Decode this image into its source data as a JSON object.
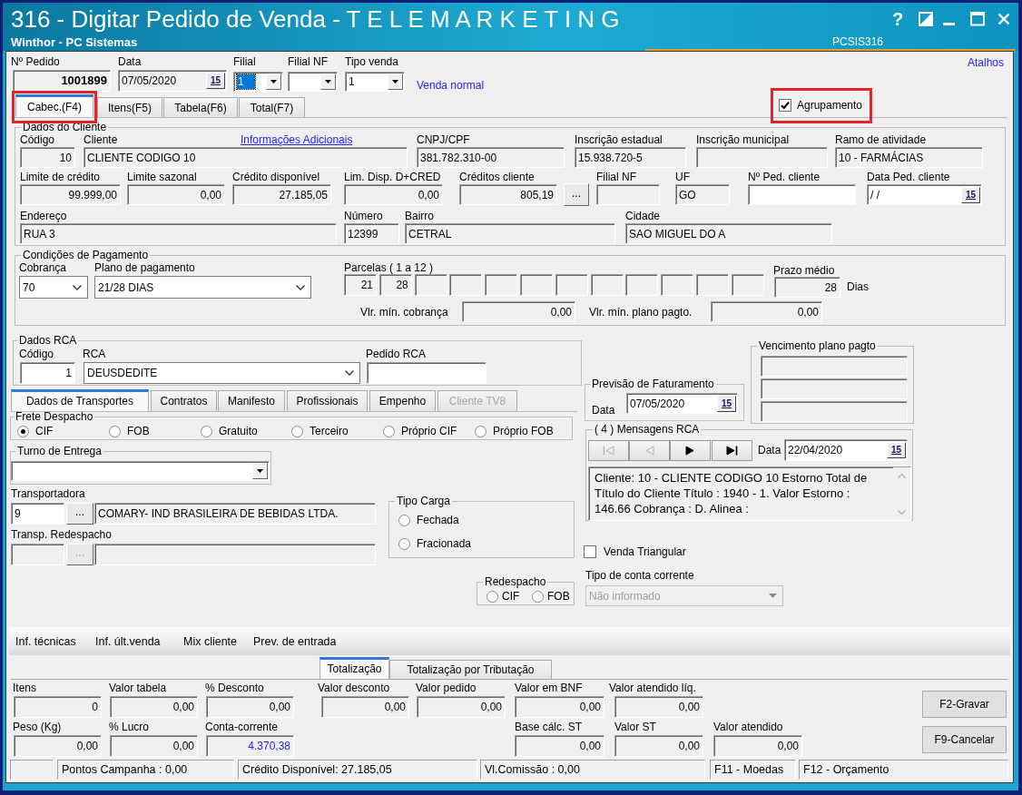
{
  "window": {
    "title": "316 - Digitar Pedido de Venda - T E L E M A R K E T I N G",
    "subtitle": "Winthor - PC Sistemas",
    "program_code": "PCSIS316",
    "help": "?"
  },
  "header": {
    "fields": [
      {
        "kind": "text",
        "label": "Nº Pedido",
        "value": "1001899",
        "readonly": true
      },
      {
        "kind": "date",
        "label": "Data",
        "value": "07/05/2020",
        "calendar": "15",
        "readonly": true
      },
      {
        "kind": "dropdown",
        "label": "Filial",
        "value": "1",
        "readonly": false,
        "focused": true
      },
      {
        "kind": "dropdown",
        "label": "Filial NF",
        "readonly": false,
        "focused": false
      },
      {
        "kind": "dropdown",
        "label": "Tipo venda",
        "value": "1",
        "readonly": false,
        "focused": false
      }
    ],
    "sale_type": "Venda normal",
    "shortcuts_link": "Atalhos"
  },
  "tabs": [
    {
      "label": "Cabec.(F4)",
      "selected": true,
      "highlighted": true
    },
    {
      "label": "Itens(F5)",
      "selected": false,
      "highlighted": false
    },
    {
      "label": "Tabela(F6)",
      "selected": false,
      "highlighted": false
    },
    {
      "label": "Total(F7)",
      "selected": false,
      "highlighted": false
    }
  ],
  "grouping": {
    "label": "Agrupamento",
    "checked": true,
    "highlighted": true
  },
  "client": {
    "title": "Dados do Cliente",
    "info_link": "Informações Adicionais",
    "fields": [
      {
        "kind": "text",
        "label": "Código",
        "value": "10",
        "readonly": true
      },
      {
        "kind": "text",
        "label": "Cliente",
        "value": "CLIENTE CODIGO 10",
        "readonly": true
      },
      {
        "kind": "text",
        "label": "CNPJ/CPF",
        "value": "381.782.310-00",
        "readonly": true
      },
      {
        "kind": "text",
        "label": "Inscrição estadual",
        "value": "15.938.720-5",
        "readonly": true
      },
      {
        "kind": "text",
        "label": "Inscrição municipal",
        "readonly": true
      },
      {
        "kind": "text",
        "label": "Ramo de atividade",
        "value": "10 - FARMÁCIAS",
        "readonly": true
      },
      {
        "kind": "text",
        "label": "Limite de crédito",
        "value": "99.999,00",
        "readonly": true
      },
      {
        "kind": "text",
        "label": "Limite sazonal",
        "value": "0,00",
        "readonly": true
      },
      {
        "kind": "text",
        "label": "Crédito disponível",
        "value": "27.185,05",
        "readonly": true
      },
      {
        "kind": "text",
        "label": "Lim. Disp. D+CRED",
        "value": "0,00",
        "readonly": true
      },
      {
        "kind": "text",
        "label": "Créditos cliente",
        "value": "805,19",
        "readonly": true,
        "button": "..."
      },
      {
        "kind": "text",
        "label": "Filial NF",
        "readonly": true
      },
      {
        "kind": "text",
        "label": "UF",
        "value": "GO",
        "readonly": true
      },
      {
        "kind": "text",
        "label": "Nº Ped. cliente",
        "readonly": false
      },
      {
        "kind": "date",
        "label": "Data Ped. cliente",
        "value": "/ /",
        "calendar": "15",
        "readonly": false
      },
      {
        "kind": "text",
        "label": "Endereço",
        "value": "RUA 3",
        "readonly": true
      },
      {
        "kind": "text",
        "label": "Número",
        "value": "12399",
        "readonly": true
      },
      {
        "kind": "text",
        "label": "Bairro",
        "value": "CETRAL",
        "readonly": true
      },
      {
        "kind": "text",
        "label": "Cidade",
        "value": "SAO MIGUEL DO A",
        "readonly": true
      }
    ]
  },
  "payment": {
    "title": "Condições de Pagamento",
    "fields": [
      {
        "kind": "select",
        "label": "Cobrança",
        "value": "70",
        "readonly": false
      },
      {
        "kind": "select",
        "label": "Plano de pagamento",
        "value": "21/28 DIAS",
        "readonly": false
      }
    ],
    "installments": {
      "label": "Parcelas ( 1 a 12 )",
      "values": [
        "21",
        "28"
      ],
      "readonly": true
    },
    "average_term": {
      "label": "Prazo médio",
      "value": "28",
      "unit": "Dias",
      "readonly": true
    },
    "minimums": [
      {
        "label": "Vlr. mín. cobrança",
        "value": "0,00",
        "readonly": true
      },
      {
        "label": "Vlr. mín. plano pagto.",
        "value": "0,00",
        "readonly": true
      }
    ]
  },
  "rca": {
    "title": "Dados RCA",
    "fields": [
      {
        "kind": "text",
        "label": "Código",
        "value": "1",
        "readonly": false
      },
      {
        "kind": "select",
        "label": "RCA",
        "value": "DEUSDEDITE",
        "readonly": false
      },
      {
        "kind": "text",
        "label": "Pedido RCA",
        "readonly": false
      }
    ]
  },
  "subtabs": [
    {
      "label": "Dados de Transportes",
      "selected": true,
      "disabled": false
    },
    {
      "label": "Contratos",
      "selected": false,
      "disabled": false
    },
    {
      "label": "Manifesto",
      "selected": false,
      "disabled": false
    },
    {
      "label": "Profissionais",
      "selected": false,
      "disabled": false
    },
    {
      "label": "Empenho",
      "selected": false,
      "disabled": false
    },
    {
      "label": "Cliente TV8",
      "selected": false,
      "disabled": true
    }
  ],
  "freight": {
    "title": "Frete Despacho",
    "options": [
      {
        "label": "CIF",
        "selected": true
      },
      {
        "label": "FOB",
        "selected": false
      },
      {
        "label": "Gratuito",
        "selected": false
      },
      {
        "label": "Terceiro",
        "selected": false
      },
      {
        "label": "Próprio CIF",
        "selected": false
      },
      {
        "label": "Próprio FOB",
        "selected": false
      }
    ]
  },
  "delivery_shift": {
    "title": "Turno de Entrega",
    "readonly": false
  },
  "carrier": {
    "label": "Transportadora",
    "code": "9",
    "button": "...",
    "name": "COMARY- IND BRASILEIRA DE BEBIDAS LTDA.",
    "disabled": false
  },
  "redispatch_carrier": {
    "label": "Transp. Redespacho",
    "button": "...",
    "disabled": true
  },
  "cargo_type": {
    "title": "Tipo Carga",
    "options": [
      {
        "label": "Fechada",
        "selected": false
      },
      {
        "label": "Fracionada",
        "selected": false
      }
    ]
  },
  "redispatch": {
    "title": "Redespacho",
    "options": [
      {
        "label": "CIF",
        "selected": false
      },
      {
        "label": "FOB",
        "selected": false
      }
    ]
  },
  "billing_forecast": {
    "title": "Previsão de Faturamento",
    "label": "Data",
    "value": "07/05/2020",
    "calendar": "15",
    "readonly": false
  },
  "payment_due": {
    "title": "Vencimento plano pagto"
  },
  "rca_messages": {
    "title": "( 4 ) Mensagens RCA",
    "nav": [
      {
        "kind": "first",
        "disabled": true
      },
      {
        "kind": "previous",
        "disabled": true
      },
      {
        "kind": "next",
        "disabled": false
      },
      {
        "kind": "last",
        "disabled": false
      }
    ],
    "date_label": "Data",
    "date": "22/04/2020",
    "calendar": "15",
    "message": "Cliente: 10 - CLIENTE CODIGO 10 Estorno Total de Título do Cliente Título : 1940 - 1. Valor Estorno : 146.66 Cobrança : D. Alinea :"
  },
  "triangular_sale": {
    "label": "Venda Triangular",
    "checked": false
  },
  "account_type": {
    "label": "Tipo de conta corrente",
    "value": "Não informado",
    "disabled": true
  },
  "toolbar": [
    "Inf. técnicas",
    "Inf. últ.venda",
    "Mix cliente",
    "Prev. de entrada"
  ],
  "totals": {
    "tabs": [
      {
        "label": "Totalização",
        "selected": true
      },
      {
        "label": "Totalização por Tributação",
        "selected": false
      }
    ],
    "fields": [
      {
        "label": "Itens",
        "value": "0"
      },
      {
        "label": "Valor tabela",
        "value": "0,00"
      },
      {
        "label": "% Desconto",
        "value": "0,00"
      },
      {
        "label": "Valor desconto",
        "value": "0,00"
      },
      {
        "label": "Valor pedido",
        "value": "0,00"
      },
      {
        "label": "Valor em BNF",
        "value": "0,00"
      },
      {
        "label": "Valor atendido líq.",
        "value": "0,00"
      },
      {
        "label": "Peso (Kg)",
        "value": "0,00"
      },
      {
        "label": "% Lucro",
        "value": "0,00"
      },
      {
        "label": "Conta-corrente",
        "value": "4.370,38",
        "color": "#2424f0"
      },
      {
        "label": "Base cálc. ST",
        "value": "0,00"
      },
      {
        "label": "Valor ST",
        "value": "0,00"
      },
      {
        "label": "Valor atendido",
        "value": "0,00"
      }
    ],
    "buttons": [
      "F2-Gravar",
      "F9-Cancelar"
    ]
  },
  "status_bar": [
    "Pontos Campanha : 0,00",
    "Crédito Disponível: 27.185,05",
    "Vl.Comissão : 0,00",
    "F11 - Moedas",
    "F12 - Orçamento"
  ]
}
